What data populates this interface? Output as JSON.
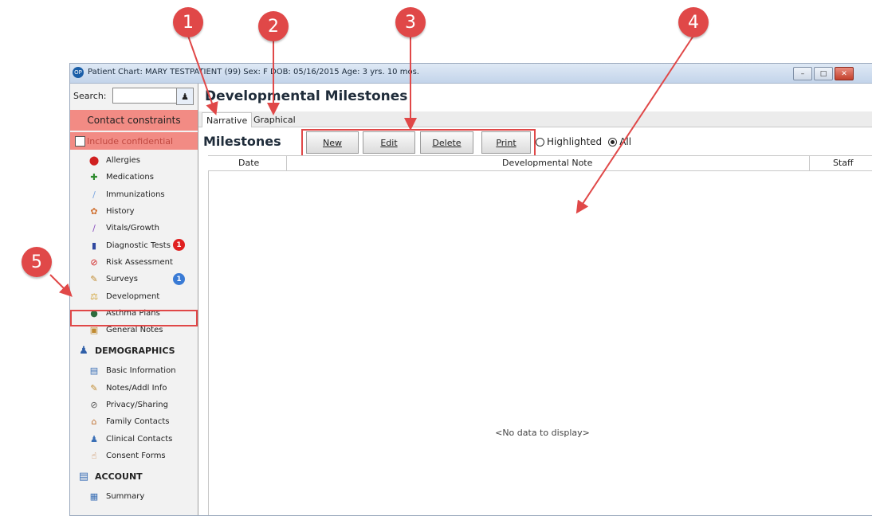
{
  "window": {
    "title": "Patient Chart: MARY TESTPATIENT (99)  Sex: F  DOB: 05/16/2015  Age: 3 yrs. 10 mos.",
    "app_icon": "OP",
    "controls": [
      "minimize-icon",
      "maximize-icon",
      "close-icon"
    ]
  },
  "sidebar": {
    "search_label": "Search:",
    "search_placeholder": "",
    "contact_constraints": "Contact constraints",
    "include_confidential": "Include confidential",
    "items": [
      {
        "label": "Allergies",
        "icon": "allergy-icon"
      },
      {
        "label": "Medications",
        "icon": "medication-icon"
      },
      {
        "label": "Immunizations",
        "icon": "syringe-icon"
      },
      {
        "label": "History",
        "icon": "history-icon"
      },
      {
        "label": "Vitals/Growth",
        "icon": "vitals-icon"
      },
      {
        "label": "Diagnostic Tests",
        "icon": "test-tubes-icon",
        "badge": "1"
      },
      {
        "label": "Risk Assessment",
        "icon": "risk-icon"
      },
      {
        "label": "Surveys",
        "icon": "survey-icon",
        "badge": "1"
      },
      {
        "label": "Development",
        "icon": "development-icon"
      },
      {
        "label": "Asthma Plans",
        "icon": "asthma-icon"
      },
      {
        "label": "General Notes",
        "icon": "notes-icon"
      }
    ],
    "demographics": {
      "title": "DEMOGRAPHICS",
      "items": [
        {
          "label": "Basic Information"
        },
        {
          "label": "Notes/Addl Info"
        },
        {
          "label": "Privacy/Sharing"
        },
        {
          "label": "Family Contacts"
        },
        {
          "label": "Clinical Contacts"
        },
        {
          "label": "Consent Forms"
        }
      ]
    },
    "account": {
      "title": "ACCOUNT",
      "items": [
        {
          "label": "Summary"
        }
      ]
    }
  },
  "main": {
    "title": "Developmental Milestones",
    "tabs": [
      {
        "label": "Narrative",
        "active": true
      },
      {
        "label": "Graphical",
        "active": false
      }
    ],
    "section_title": "Milestones",
    "buttons": {
      "new": "New",
      "edit": "Edit",
      "delete": "Delete",
      "print": "Print"
    },
    "filter": {
      "highlighted": "Highlighted",
      "all": "All",
      "selected": "All"
    },
    "columns": [
      "Date",
      "Developmental Note",
      "Staff"
    ],
    "empty_text": "<No data to display>"
  },
  "callouts": [
    "1",
    "2",
    "3",
    "4",
    "5"
  ],
  "colors": {
    "callout": "#e04848",
    "contact_bg": "#f28b84",
    "badge_red": "#e02020",
    "badge_blue": "#3a7bd5"
  }
}
